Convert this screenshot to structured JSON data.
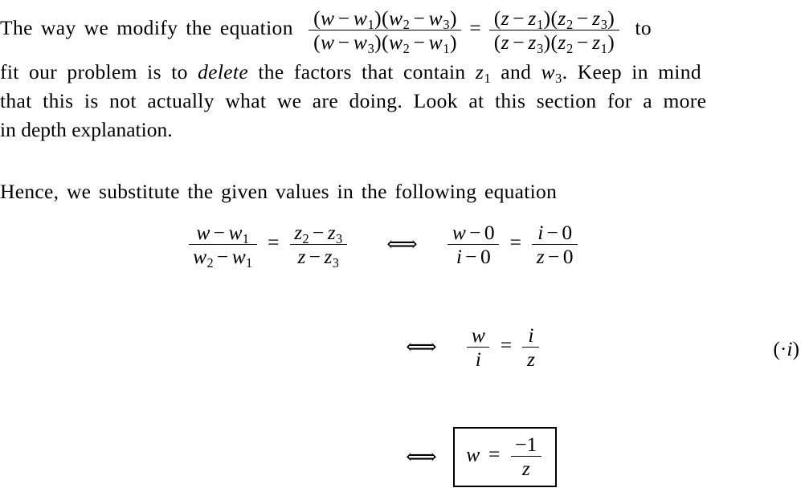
{
  "document": {
    "kind": "latex-math-note",
    "background_color": "#ffffff",
    "text_color": "#000000"
  },
  "paragraph1": {
    "line1_before": "The way we modify the equation",
    "line1_after": "to",
    "line2_a": "fit our problem is to",
    "line2_emph": "delete",
    "line2_b": "the factors that contain",
    "line2_c": "and",
    "line2_d": ". Keep in mind",
    "line3": "that this is not actually what we are doing. Look at this section for a more",
    "line4": "in depth explanation."
  },
  "paragraph2": {
    "line1": "Hence, we substitute the given values in the following equation"
  },
  "symbols": {
    "w": "w",
    "z": "z",
    "i": "i",
    "minus": "−",
    "equals": "=",
    "iff": "⟺",
    "lparen": "(",
    "rparen": ")",
    "zero": "0",
    "one": "1",
    "cdot": "·",
    "sub1": "1",
    "sub2": "2",
    "sub3": "3"
  },
  "cross_ratio_equation": {
    "lhs": {
      "numerator": "(w − w₁)(w₂ − w₃)",
      "denominator": "(w − w₃)(w₂ − w₁)"
    },
    "relation": "=",
    "rhs": {
      "numerator": "(z − z₁)(z₂ − z₃)",
      "denominator": "(z − z₃)(z₂ − z₁)"
    }
  },
  "display_line_1": {
    "left": {
      "numerator": "w − w₁",
      "denominator": "w₂ − w₁"
    },
    "relation": "=",
    "right": {
      "numerator": "z₂ − z₃",
      "denominator": "z − z₃"
    },
    "iff": "⟺",
    "substituted_left": {
      "numerator": "w − 0",
      "denominator": "i − 0"
    },
    "substituted_relation": "=",
    "substituted_right": {
      "numerator": "i − 0",
      "denominator": "z − 0"
    }
  },
  "display_line_2": {
    "iff": "⟺",
    "left": {
      "numerator": "w",
      "denominator": "i"
    },
    "relation": "=",
    "right": {
      "numerator": "i",
      "denominator": "z"
    },
    "tag": "(·i)"
  },
  "display_line_3": {
    "iff": "⟺",
    "boxed": {
      "lhs": "w",
      "relation": "=",
      "numerator": "−1",
      "denominator": "z"
    }
  }
}
